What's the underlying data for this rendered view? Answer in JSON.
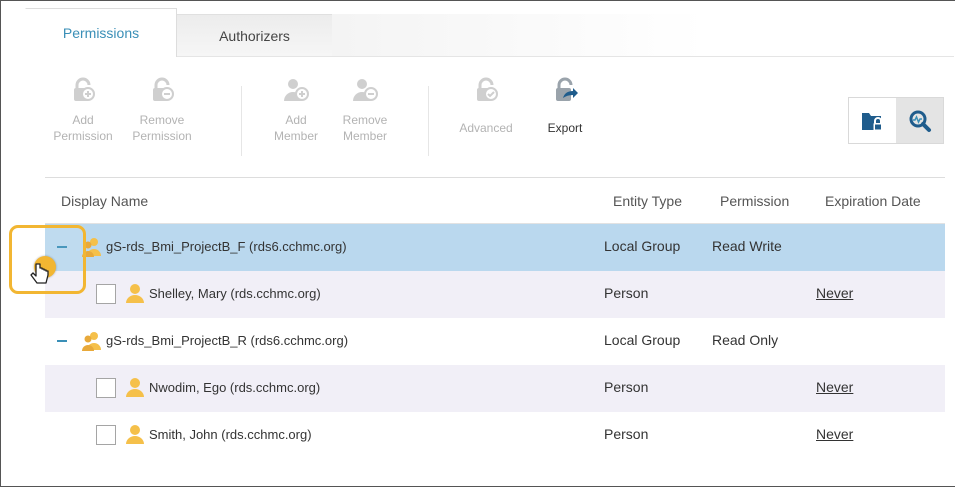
{
  "tabs": [
    {
      "label": "Permissions",
      "active": true
    },
    {
      "label": "Authorizers",
      "active": false
    }
  ],
  "toolbar": {
    "add_permission": "Add\nPermission",
    "remove_permission": "Remove\nPermission",
    "add_member": "Add\nMember",
    "remove_member": "Remove\nMember",
    "advanced": "Advanced",
    "export": "Export"
  },
  "columns": {
    "display_name": "Display Name",
    "entity_type": "Entity Type",
    "permission": "Permission",
    "expiration_date": "Expiration Date"
  },
  "rows": [
    {
      "name": "gS-rds_Bmi_ProjectB_F (rds6.cchmc.org)",
      "type": "Local Group",
      "permission": "Read Write",
      "expiration": ""
    },
    {
      "name": "Shelley, Mary (rds.cchmc.org)",
      "type": "Person",
      "permission": "",
      "expiration": "Never"
    },
    {
      "name": "gS-rds_Bmi_ProjectB_R (rds6.cchmc.org)",
      "type": "Local Group",
      "permission": "Read Only",
      "expiration": ""
    },
    {
      "name": "Nwodim, Ego (rds.cchmc.org)",
      "type": "Person",
      "permission": "",
      "expiration": "Never"
    },
    {
      "name": "Smith, John (rds.cchmc.org)",
      "type": "Person",
      "permission": "",
      "expiration": "Never"
    }
  ],
  "colors": {
    "accent": "#3a8fb7",
    "selected_row": "#bad8ee",
    "child_row": "#f1eff7",
    "highlight": "#f2b632",
    "person_icon": "#f5c04a",
    "export_icon": "#1f5c8c"
  }
}
